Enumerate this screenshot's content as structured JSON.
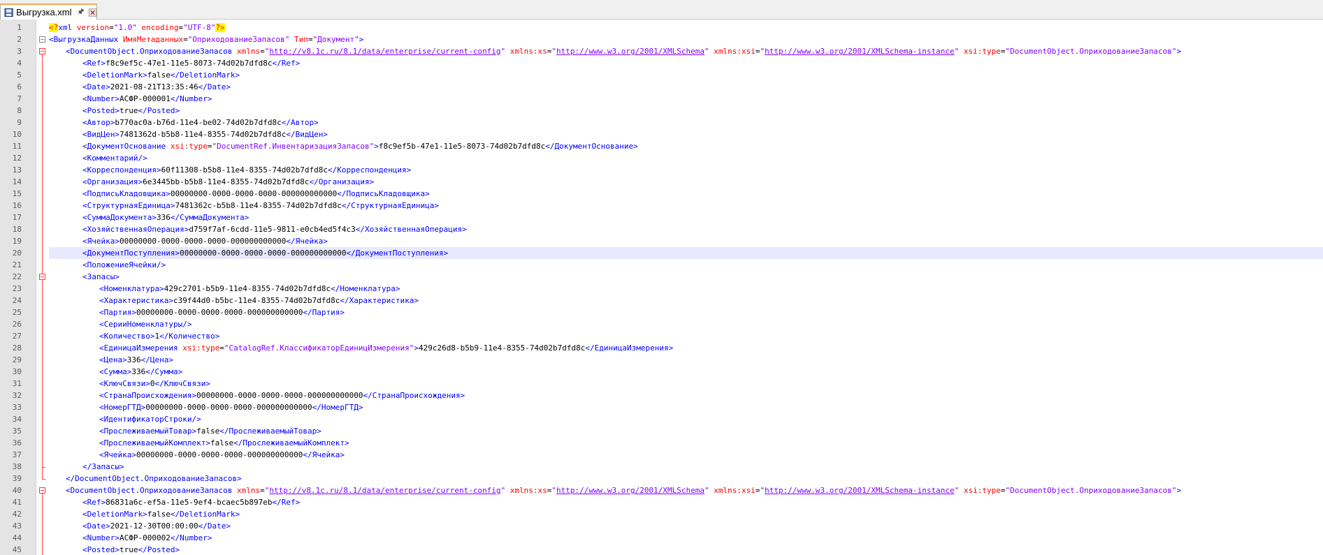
{
  "tab": {
    "label": "Выгрузка.xml",
    "pinned": true,
    "icon": "xml-file-icon"
  },
  "colors": {
    "tag": "#0000ff",
    "attr": "#ff0000",
    "value": "#8000ff",
    "pi_background": "#ffff00",
    "current_line": "#e8e8ff",
    "fold_marker": "#ff3c3c",
    "tab_accent": "#f6a84c"
  },
  "current_line": 20,
  "lines": [
    {
      "n": "1",
      "indent": 0,
      "tokens": [
        {
          "t": "<?",
          "c": "pi"
        },
        {
          "t": "xml",
          "c": "tag"
        },
        {
          "t": " version",
          "c": "attr"
        },
        {
          "t": "=",
          "c": "eq"
        },
        {
          "t": "\"1.0\"",
          "c": "val"
        },
        {
          "t": " encoding",
          "c": "attr"
        },
        {
          "t": "=",
          "c": "eq"
        },
        {
          "t": "\"UTF-8\"",
          "c": "val"
        },
        {
          "t": "?>",
          "c": "pi"
        }
      ]
    },
    {
      "n": "2",
      "indent": 0,
      "tokens": [
        {
          "t": "<ВыгрузкаДанных",
          "c": "tag"
        },
        {
          "t": " ИмяМетаданных",
          "c": "attr"
        },
        {
          "t": "=",
          "c": "eq"
        },
        {
          "t": "\"ОприходованиеЗапасов\"",
          "c": "val"
        },
        {
          "t": " Тип",
          "c": "attr"
        },
        {
          "t": "=",
          "c": "eq"
        },
        {
          "t": "\"Документ\"",
          "c": "val"
        },
        {
          "t": ">",
          "c": "tag"
        }
      ]
    },
    {
      "n": "3",
      "indent": 1,
      "tokens": [
        {
          "t": "<DocumentObject.ОприходованиеЗапасов",
          "c": "tag"
        },
        {
          "t": " xmlns",
          "c": "attr"
        },
        {
          "t": "=",
          "c": "eq"
        },
        {
          "t": "\"",
          "c": "val"
        },
        {
          "t": "http://v8.1c.ru/8.1/data/enterprise/current-config",
          "c": "url"
        },
        {
          "t": "\"",
          "c": "val"
        },
        {
          "t": " xmlns:xs",
          "c": "attr"
        },
        {
          "t": "=",
          "c": "eq"
        },
        {
          "t": "\"",
          "c": "val"
        },
        {
          "t": "http://www.w3.org/2001/XMLSchema",
          "c": "url"
        },
        {
          "t": "\"",
          "c": "val"
        },
        {
          "t": " xmlns:xsi",
          "c": "attr"
        },
        {
          "t": "=",
          "c": "eq"
        },
        {
          "t": "\"",
          "c": "val"
        },
        {
          "t": "http://www.w3.org/2001/XMLSchema-instance",
          "c": "url"
        },
        {
          "t": "\"",
          "c": "val"
        },
        {
          "t": " xsi:type",
          "c": "attr"
        },
        {
          "t": "=",
          "c": "eq"
        },
        {
          "t": "\"DocumentObject.ОприходованиеЗапасов\"",
          "c": "val"
        },
        {
          "t": ">",
          "c": "tag"
        }
      ]
    },
    {
      "n": "4",
      "indent": 2,
      "tokens": [
        {
          "t": "<Ref>",
          "c": "tag"
        },
        {
          "t": "f8c9ef5c-47e1-11e5-8073-74d02b7dfd8c",
          "c": "text"
        },
        {
          "t": "</Ref>",
          "c": "tag"
        }
      ]
    },
    {
      "n": "5",
      "indent": 2,
      "tokens": [
        {
          "t": "<DeletionMark>",
          "c": "tag"
        },
        {
          "t": "false",
          "c": "text"
        },
        {
          "t": "</DeletionMark>",
          "c": "tag"
        }
      ]
    },
    {
      "n": "6",
      "indent": 2,
      "tokens": [
        {
          "t": "<Date>",
          "c": "tag"
        },
        {
          "t": "2021-08-21T13:35:46",
          "c": "text"
        },
        {
          "t": "</Date>",
          "c": "tag"
        }
      ]
    },
    {
      "n": "7",
      "indent": 2,
      "tokens": [
        {
          "t": "<Number>",
          "c": "tag"
        },
        {
          "t": "АСФР-000001",
          "c": "text"
        },
        {
          "t": "</Number>",
          "c": "tag"
        }
      ]
    },
    {
      "n": "8",
      "indent": 2,
      "tokens": [
        {
          "t": "<Posted>",
          "c": "tag"
        },
        {
          "t": "true",
          "c": "text"
        },
        {
          "t": "</Posted>",
          "c": "tag"
        }
      ]
    },
    {
      "n": "9",
      "indent": 2,
      "tokens": [
        {
          "t": "<Автор>",
          "c": "tag"
        },
        {
          "t": "b770ac0a-b76d-11e4-be02-74d02b7dfd8c",
          "c": "text"
        },
        {
          "t": "</Автор>",
          "c": "tag"
        }
      ]
    },
    {
      "n": "10",
      "indent": 2,
      "tokens": [
        {
          "t": "<ВидЦен>",
          "c": "tag"
        },
        {
          "t": "7481362d-b5b8-11e4-8355-74d02b7dfd8c",
          "c": "text"
        },
        {
          "t": "</ВидЦен>",
          "c": "tag"
        }
      ]
    },
    {
      "n": "11",
      "indent": 2,
      "tokens": [
        {
          "t": "<ДокументОснование",
          "c": "tag"
        },
        {
          "t": " xsi:type",
          "c": "attr"
        },
        {
          "t": "=",
          "c": "eq"
        },
        {
          "t": "\"DocumentRef.ИнвентаризацияЗапасов\"",
          "c": "val"
        },
        {
          "t": ">",
          "c": "tag"
        },
        {
          "t": "f8c9ef5b-47e1-11e5-8073-74d02b7dfd8c",
          "c": "text"
        },
        {
          "t": "</ДокументОснование>",
          "c": "tag"
        }
      ]
    },
    {
      "n": "12",
      "indent": 2,
      "tokens": [
        {
          "t": "<Комментарий/>",
          "c": "tag"
        }
      ]
    },
    {
      "n": "13",
      "indent": 2,
      "tokens": [
        {
          "t": "<Корреспонденция>",
          "c": "tag"
        },
        {
          "t": "60f11308-b5b8-11e4-8355-74d02b7dfd8c",
          "c": "text"
        },
        {
          "t": "</Корреспонденция>",
          "c": "tag"
        }
      ]
    },
    {
      "n": "14",
      "indent": 2,
      "tokens": [
        {
          "t": "<Организация>",
          "c": "tag"
        },
        {
          "t": "6e3445bb-b5b8-11e4-8355-74d02b7dfd8c",
          "c": "text"
        },
        {
          "t": "</Организация>",
          "c": "tag"
        }
      ]
    },
    {
      "n": "15",
      "indent": 2,
      "tokens": [
        {
          "t": "<ПодписьКладовщика>",
          "c": "tag"
        },
        {
          "t": "00000000-0000-0000-0000-000000000000",
          "c": "text"
        },
        {
          "t": "</ПодписьКладовщика>",
          "c": "tag"
        }
      ]
    },
    {
      "n": "16",
      "indent": 2,
      "tokens": [
        {
          "t": "<СтруктурнаяЕдиница>",
          "c": "tag"
        },
        {
          "t": "7481362c-b5b8-11e4-8355-74d02b7dfd8c",
          "c": "text"
        },
        {
          "t": "</СтруктурнаяЕдиница>",
          "c": "tag"
        }
      ]
    },
    {
      "n": "17",
      "indent": 2,
      "tokens": [
        {
          "t": "<СуммаДокумента>",
          "c": "tag"
        },
        {
          "t": "336",
          "c": "text"
        },
        {
          "t": "</СуммаДокумента>",
          "c": "tag"
        }
      ]
    },
    {
      "n": "18",
      "indent": 2,
      "tokens": [
        {
          "t": "<ХозяйственнаяОперация>",
          "c": "tag"
        },
        {
          "t": "d759f7af-6cdd-11e5-9811-e0cb4ed5f4c3",
          "c": "text"
        },
        {
          "t": "</ХозяйственнаяОперация>",
          "c": "tag"
        }
      ]
    },
    {
      "n": "19",
      "indent": 2,
      "tokens": [
        {
          "t": "<Ячейка>",
          "c": "tag"
        },
        {
          "t": "00000000-0000-0000-0000-000000000000",
          "c": "text"
        },
        {
          "t": "</Ячейка>",
          "c": "tag"
        }
      ]
    },
    {
      "n": "20",
      "indent": 2,
      "tokens": [
        {
          "t": "<ДокументПоступления>",
          "c": "tag"
        },
        {
          "t": "00000000-0000-0000-0000-000000000000",
          "c": "text"
        },
        {
          "t": "</ДокументПоступления>",
          "c": "tag"
        }
      ]
    },
    {
      "n": "21",
      "indent": 2,
      "tokens": [
        {
          "t": "<ПоложениеЯчейки/>",
          "c": "tag"
        }
      ]
    },
    {
      "n": "22",
      "indent": 2,
      "tokens": [
        {
          "t": "<Запасы>",
          "c": "tag"
        }
      ]
    },
    {
      "n": "23",
      "indent": 3,
      "tokens": [
        {
          "t": "<Номенклатура>",
          "c": "tag"
        },
        {
          "t": "429c2701-b5b9-11e4-8355-74d02b7dfd8c",
          "c": "text"
        },
        {
          "t": "</Номенклатура>",
          "c": "tag"
        }
      ]
    },
    {
      "n": "24",
      "indent": 3,
      "tokens": [
        {
          "t": "<Характеристика>",
          "c": "tag"
        },
        {
          "t": "c39f44d0-b5bc-11e4-8355-74d02b7dfd8c",
          "c": "text"
        },
        {
          "t": "</Характеристика>",
          "c": "tag"
        }
      ]
    },
    {
      "n": "25",
      "indent": 3,
      "tokens": [
        {
          "t": "<Партия>",
          "c": "tag"
        },
        {
          "t": "00000000-0000-0000-0000-000000000000",
          "c": "text"
        },
        {
          "t": "</Партия>",
          "c": "tag"
        }
      ]
    },
    {
      "n": "26",
      "indent": 3,
      "tokens": [
        {
          "t": "<СерииНоменклатуры/>",
          "c": "tag"
        }
      ]
    },
    {
      "n": "27",
      "indent": 3,
      "tokens": [
        {
          "t": "<Количество>",
          "c": "tag"
        },
        {
          "t": "1",
          "c": "text"
        },
        {
          "t": "</Количество>",
          "c": "tag"
        }
      ]
    },
    {
      "n": "28",
      "indent": 3,
      "tokens": [
        {
          "t": "<ЕдиницаИзмерения",
          "c": "tag"
        },
        {
          "t": " xsi:type",
          "c": "attr"
        },
        {
          "t": "=",
          "c": "eq"
        },
        {
          "t": "\"CatalogRef.КлассификаторЕдиницИзмерения\"",
          "c": "val"
        },
        {
          "t": ">",
          "c": "tag"
        },
        {
          "t": "429c26d8-b5b9-11e4-8355-74d02b7dfd8c",
          "c": "text"
        },
        {
          "t": "</ЕдиницаИзмерения>",
          "c": "tag"
        }
      ]
    },
    {
      "n": "29",
      "indent": 3,
      "tokens": [
        {
          "t": "<Цена>",
          "c": "tag"
        },
        {
          "t": "336",
          "c": "text"
        },
        {
          "t": "</Цена>",
          "c": "tag"
        }
      ]
    },
    {
      "n": "30",
      "indent": 3,
      "tokens": [
        {
          "t": "<Сумма>",
          "c": "tag"
        },
        {
          "t": "336",
          "c": "text"
        },
        {
          "t": "</Сумма>",
          "c": "tag"
        }
      ]
    },
    {
      "n": "31",
      "indent": 3,
      "tokens": [
        {
          "t": "<КлючСвязи>",
          "c": "tag"
        },
        {
          "t": "0",
          "c": "text"
        },
        {
          "t": "</КлючСвязи>",
          "c": "tag"
        }
      ]
    },
    {
      "n": "32",
      "indent": 3,
      "tokens": [
        {
          "t": "<СтранаПроисхождения>",
          "c": "tag"
        },
        {
          "t": "00000000-0000-0000-0000-000000000000",
          "c": "text"
        },
        {
          "t": "</СтранаПроисхождения>",
          "c": "tag"
        }
      ]
    },
    {
      "n": "33",
      "indent": 3,
      "tokens": [
        {
          "t": "<НомерГТД>",
          "c": "tag"
        },
        {
          "t": "00000000-0000-0000-0000-000000000000",
          "c": "text"
        },
        {
          "t": "</НомерГТД>",
          "c": "tag"
        }
      ]
    },
    {
      "n": "34",
      "indent": 3,
      "tokens": [
        {
          "t": "<ИдентификаторСтроки/>",
          "c": "tag"
        }
      ]
    },
    {
      "n": "35",
      "indent": 3,
      "tokens": [
        {
          "t": "<ПрослеживаемыйТовар>",
          "c": "tag"
        },
        {
          "t": "false",
          "c": "text"
        },
        {
          "t": "</ПрослеживаемыйТовар>",
          "c": "tag"
        }
      ]
    },
    {
      "n": "36",
      "indent": 3,
      "tokens": [
        {
          "t": "<ПрослеживаемыйКомплект>",
          "c": "tag"
        },
        {
          "t": "false",
          "c": "text"
        },
        {
          "t": "</ПрослеживаемыйКомплект>",
          "c": "tag"
        }
      ]
    },
    {
      "n": "37",
      "indent": 3,
      "tokens": [
        {
          "t": "<Ячейка>",
          "c": "tag"
        },
        {
          "t": "00000000-0000-0000-0000-000000000000",
          "c": "text"
        },
        {
          "t": "</Ячейка>",
          "c": "tag"
        }
      ]
    },
    {
      "n": "38",
      "indent": 2,
      "tokens": [
        {
          "t": "</Запасы>",
          "c": "tag"
        }
      ]
    },
    {
      "n": "39",
      "indent": 1,
      "tokens": [
        {
          "t": "</DocumentObject.ОприходованиеЗапасов>",
          "c": "tag"
        }
      ]
    },
    {
      "n": "40",
      "indent": 1,
      "tokens": [
        {
          "t": "<DocumentObject.ОприходованиеЗапасов",
          "c": "tag"
        },
        {
          "t": " xmlns",
          "c": "attr"
        },
        {
          "t": "=",
          "c": "eq"
        },
        {
          "t": "\"",
          "c": "val"
        },
        {
          "t": "http://v8.1c.ru/8.1/data/enterprise/current-config",
          "c": "url"
        },
        {
          "t": "\"",
          "c": "val"
        },
        {
          "t": " xmlns:xs",
          "c": "attr"
        },
        {
          "t": "=",
          "c": "eq"
        },
        {
          "t": "\"",
          "c": "val"
        },
        {
          "t": "http://www.w3.org/2001/XMLSchema",
          "c": "url"
        },
        {
          "t": "\"",
          "c": "val"
        },
        {
          "t": " xmlns:xsi",
          "c": "attr"
        },
        {
          "t": "=",
          "c": "eq"
        },
        {
          "t": "\"",
          "c": "val"
        },
        {
          "t": "http://www.w3.org/2001/XMLSchema-instance",
          "c": "url"
        },
        {
          "t": "\"",
          "c": "val"
        },
        {
          "t": " xsi:type",
          "c": "attr"
        },
        {
          "t": "=",
          "c": "eq"
        },
        {
          "t": "\"DocumentObject.ОприходованиеЗапасов\"",
          "c": "val"
        },
        {
          "t": ">",
          "c": "tag"
        }
      ]
    },
    {
      "n": "41",
      "indent": 2,
      "tokens": [
        {
          "t": "<Ref>",
          "c": "tag"
        },
        {
          "t": "86831a6c-ef5a-11e5-9ef4-bcaec5b897eb",
          "c": "text"
        },
        {
          "t": "</Ref>",
          "c": "tag"
        }
      ]
    },
    {
      "n": "42",
      "indent": 2,
      "tokens": [
        {
          "t": "<DeletionMark>",
          "c": "tag"
        },
        {
          "t": "false",
          "c": "text"
        },
        {
          "t": "</DeletionMark>",
          "c": "tag"
        }
      ]
    },
    {
      "n": "43",
      "indent": 2,
      "tokens": [
        {
          "t": "<Date>",
          "c": "tag"
        },
        {
          "t": "2021-12-30T00:00:00",
          "c": "text"
        },
        {
          "t": "</Date>",
          "c": "tag"
        }
      ]
    },
    {
      "n": "44",
      "indent": 2,
      "tokens": [
        {
          "t": "<Number>",
          "c": "tag"
        },
        {
          "t": "АСФР-000002",
          "c": "text"
        },
        {
          "t": "</Number>",
          "c": "tag"
        }
      ]
    },
    {
      "n": "45",
      "indent": 2,
      "tokens": [
        {
          "t": "<Posted>",
          "c": "tag"
        },
        {
          "t": "true",
          "c": "text"
        },
        {
          "t": "</Posted>",
          "c": "tag"
        }
      ]
    }
  ]
}
